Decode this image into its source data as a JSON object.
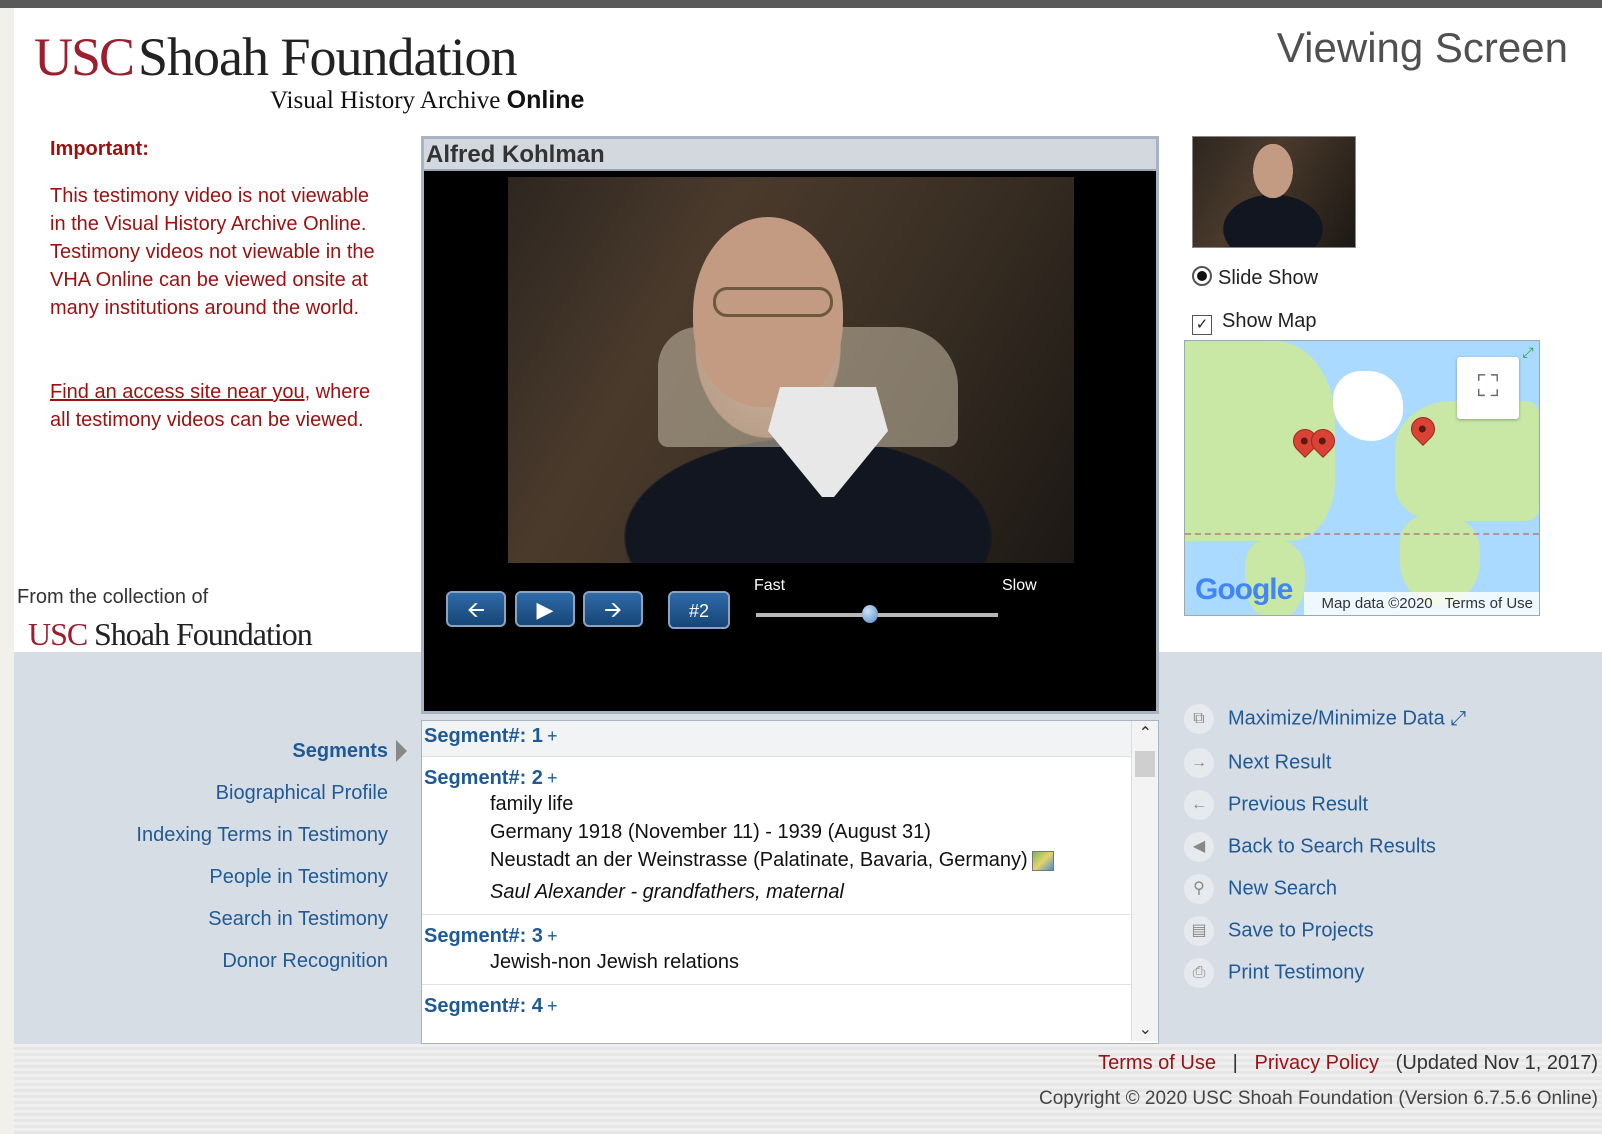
{
  "header": {
    "logo_usc": "USC",
    "logo_shoah": "Shoah Foundation",
    "logo_sub": "Visual History Archive",
    "logo_sub_bold": "Online",
    "screen_title": "Viewing Screen"
  },
  "notice": {
    "label": "Important:",
    "text": "This testimony video is not viewable in the Visual History Archive Online. Testimony videos not viewable in the VHA Online can be viewed onsite at many institutions around the world.",
    "link": "Find an access site near you",
    "link_suffix": ", where all testimony videos can be viewed."
  },
  "collection": {
    "label": "From the collection of",
    "usc": "USC",
    "shoah": "Shoah Foundation"
  },
  "viewer": {
    "title": "Alfred Kohlman",
    "slide_number": "#2",
    "speed_fast": "Fast",
    "speed_slow": "Slow",
    "speed_level": 0.47
  },
  "segments": [
    {
      "head": "Segment#: 1",
      "lines": [],
      "italic": ""
    },
    {
      "head": "Segment#: 2",
      "lines": [
        "family life",
        "Germany 1918 (November 11) - 1939 (August 31)",
        "Neustadt an der Weinstrasse (Palatinate, Bavaria, Germany)"
      ],
      "italic": "Saul Alexander - grandfathers, maternal"
    },
    {
      "head": "Segment#: 3",
      "lines": [
        "Jewish-non Jewish relations"
      ],
      "italic": ""
    },
    {
      "head": "Segment#: 4",
      "lines": [],
      "italic": ""
    }
  ],
  "segment_plus": "+",
  "nav": {
    "segments": "Segments",
    "bio": "Biographical Profile",
    "indexing": "Indexing Terms in Testimony",
    "people": "People in Testimony",
    "search": "Search in Testimony",
    "donor": "Donor Recognition"
  },
  "side": {
    "slide_show": "Slide Show",
    "show_map": "Show Map"
  },
  "map": {
    "google": "Google",
    "attribution": "Map data ©2020",
    "terms": "Terms of Use"
  },
  "actions": {
    "maximize": "Maximize/Minimize Data",
    "next": "Next Result",
    "previous": "Previous Result",
    "back": "Back to Search Results",
    "new_search": "New Search",
    "save": "Save to Projects",
    "print": "Print Testimony"
  },
  "footer": {
    "terms": "Terms of Use",
    "separator": "|",
    "privacy": "Privacy Policy",
    "updated": "(Updated Nov 1, 2017)",
    "copyright": "Copyright © 2020 USC Shoah Foundation (Version 6.7.5.6 Online)"
  }
}
